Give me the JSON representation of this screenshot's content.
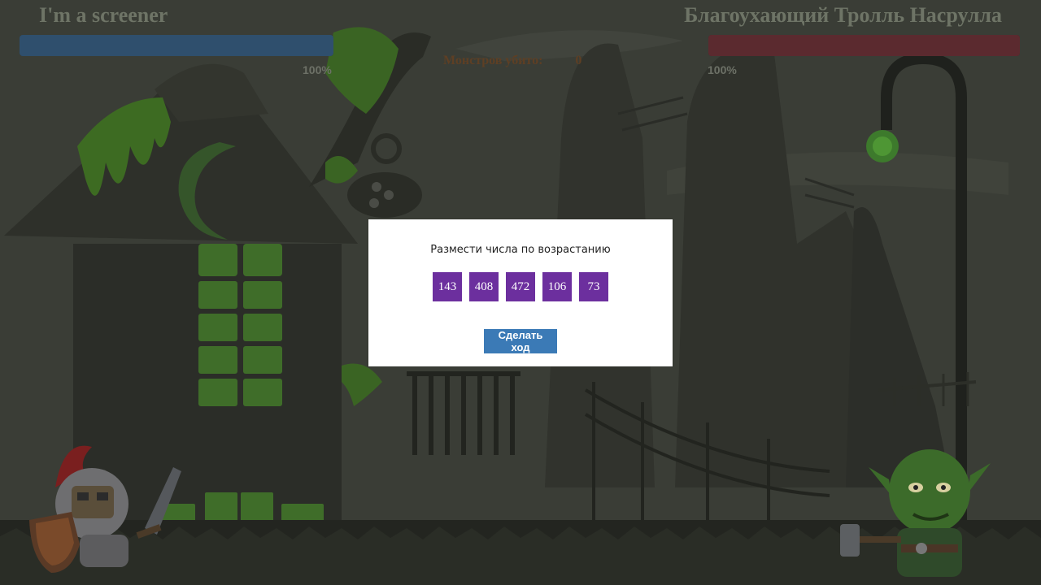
{
  "player": {
    "name": "I'm a screener",
    "hp_percent_label": "100%",
    "hp_fraction": 1.0,
    "color": "#2f4f6d"
  },
  "enemy": {
    "name": "Благоухающий Тролль Насрулла",
    "hp_percent_label": "100%",
    "hp_fraction": 1.0,
    "color": "#5b2a2f"
  },
  "score": {
    "label": "Монстров убито:",
    "value": "0"
  },
  "task": {
    "prompt": "Размести числа по возрастанию",
    "numbers": [
      "143",
      "408",
      "472",
      "106",
      "73"
    ],
    "tile_color": "#6c2f9e"
  },
  "actions": {
    "submit_label": "Сделать ход",
    "submit_color": "#3b7ab6"
  },
  "icons": {
    "player_character": "knight-icon",
    "enemy_character": "orc-troll-icon"
  }
}
